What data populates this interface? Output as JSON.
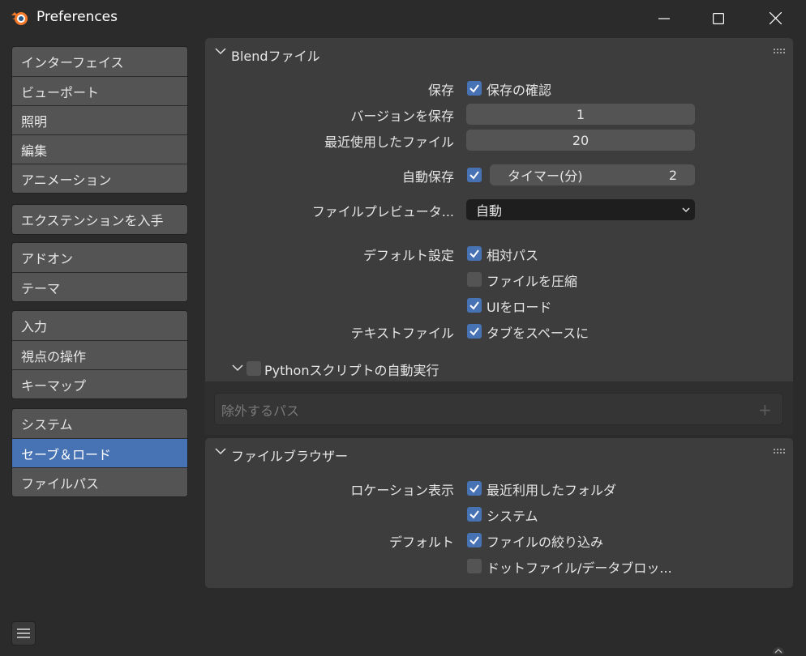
{
  "window": {
    "title": "Preferences"
  },
  "sidebar": {
    "groups": [
      [
        "インターフェイス",
        "ビューポート",
        "照明",
        "編集",
        "アニメーション"
      ],
      [
        "エクステンションを入手"
      ],
      [
        "アドオン",
        "テーマ"
      ],
      [
        "入力",
        "視点の操作",
        "キーマップ"
      ],
      [
        "システム",
        "セーブ＆ロード",
        "ファイルパス"
      ]
    ],
    "active": "セーブ＆ロード"
  },
  "blend": {
    "title": "Blendファイル",
    "save_label": "保存",
    "confirm_label": "保存の確認",
    "confirm_checked": true,
    "versions_label": "バージョンを保存",
    "versions_value": "1",
    "recent_label": "最近使用したファイル",
    "recent_value": "20",
    "autosave_label": "自動保存",
    "autosave_checked": true,
    "timer_label": "タイマー(分)",
    "timer_value": "2",
    "preview_label": "ファイルプレビュータ...",
    "preview_value": "自動",
    "defaults_label": "デフォルト設定",
    "relative_label": "相対パス",
    "relative_checked": true,
    "compress_label": "ファイルを圧縮",
    "compress_checked": false,
    "loadui_label": "UIをロード",
    "loadui_checked": true,
    "textfile_label": "テキストファイル",
    "tabs_label": "タブをスペースに",
    "tabs_checked": true,
    "python_label": "Pythonスクリプトの自動実行",
    "python_checked": false,
    "exclude_placeholder": "除外するパス",
    "add_symbol": "+"
  },
  "browser": {
    "title": "ファイルブラウザー",
    "location_label": "ロケーション表示",
    "recent_folders_label": "最近利用したフォルダ",
    "recent_folders_checked": true,
    "system_label": "システム",
    "system_checked": true,
    "default_label": "デフォルト",
    "filter_label": "ファイルの絞り込み",
    "filter_checked": true,
    "dotfiles_label": "ドットファイル/データブロッ...",
    "dotfiles_checked": false
  },
  "colors": {
    "accent": "#4772b3",
    "panel": "#3d3d3d",
    "button": "#545454",
    "background": "#2b2b2b"
  }
}
